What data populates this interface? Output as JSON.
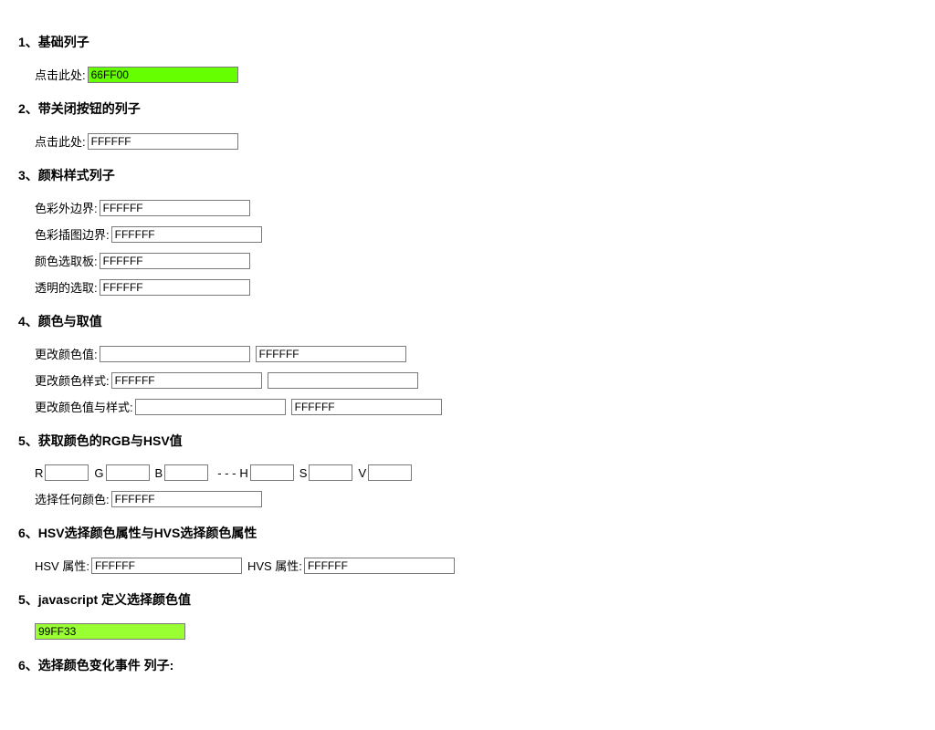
{
  "sections": [
    {
      "title": "1、基础列子"
    },
    {
      "title": "2、带关闭按钮的列子"
    },
    {
      "title": "3、颜料样式列子"
    },
    {
      "title": "4、颜色与取值"
    },
    {
      "title": "5、获取颜色的RGB与HSV值"
    },
    {
      "title": "6、HSV选择颜色属性与HVS选择颜色属性"
    },
    {
      "title": "5、javascript 定义选择颜色值"
    },
    {
      "title": "6、选择颜色变化事件 列子:"
    }
  ],
  "labels": {
    "click_here": "点击此处:",
    "outer_border": "色彩外边界:",
    "inset_border": "色彩插图边界:",
    "picker_panel": "颜色选取板:",
    "transparent_sel": "透明的选取:",
    "change_value": "更改颜色值:",
    "change_style": "更改颜色样式:",
    "change_both": "更改颜色值与样式:",
    "r": "R",
    "g": "G",
    "b": "B",
    "h": "H",
    "s": "S",
    "v": "V",
    "dash": " - - - ",
    "choose_any": "选择任何颜色:",
    "hsv_attr": "HSV 属性:",
    "hvs_attr": "HVS 属性:"
  },
  "values": {
    "v1": "66FF00",
    "white": "FFFFFF",
    "empty": "",
    "v2": "99FF33"
  }
}
